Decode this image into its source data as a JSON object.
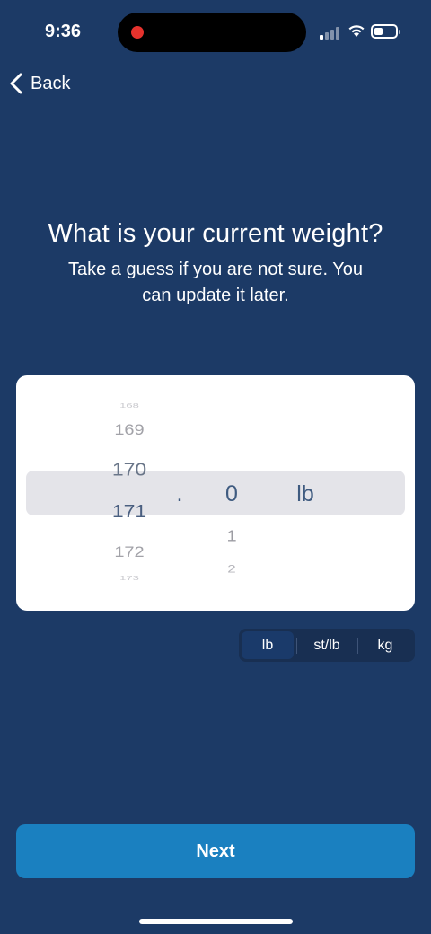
{
  "status_bar": {
    "time": "9:36",
    "recording_dot_color": "#e5322d",
    "battery_level": 0.3,
    "signal_bars": 1
  },
  "nav": {
    "back_label": "Back",
    "back_icon": "chevron-left-icon"
  },
  "heading": {
    "title": "What is your current weight?",
    "subtitle": "Take a guess if you are not sure. You can update it later."
  },
  "picker": {
    "whole_column": [
      "168",
      "169",
      "170",
      "171",
      "172",
      "173"
    ],
    "selected_whole": "171",
    "separator": ".",
    "decimal_column": [
      "0",
      "1",
      "2"
    ],
    "selected_decimal": "0",
    "unit_label": "lb"
  },
  "units": {
    "options": [
      "lb",
      "st/lb",
      "kg"
    ],
    "selected": "lb"
  },
  "next_button": {
    "label": "Next"
  },
  "colors": {
    "background": "#1c3a66",
    "primary_button": "#1a80c0",
    "picker_selection": "#e4e4e9",
    "picker_text": "#3f5b80"
  }
}
